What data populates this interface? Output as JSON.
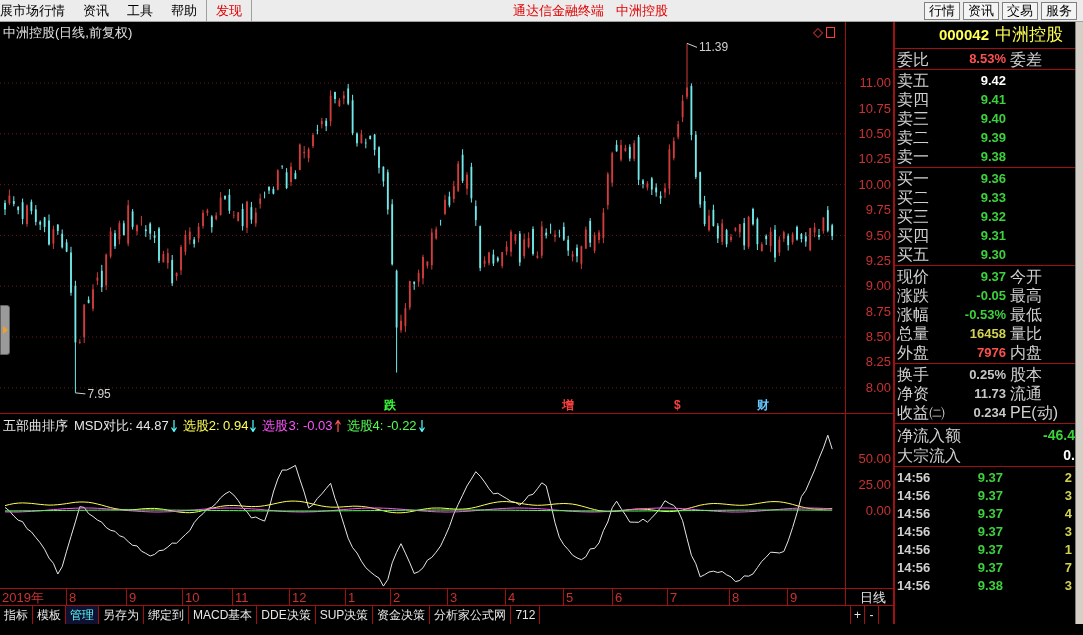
{
  "menu_bar": {
    "items": [
      {
        "label": "展市场行情",
        "kind": "menu"
      },
      {
        "label": "资讯",
        "kind": "menu"
      },
      {
        "label": "工具",
        "kind": "menu"
      },
      {
        "label": "帮助",
        "kind": "menu"
      },
      {
        "label": "发现",
        "kind": "highlight"
      }
    ],
    "app_title": "通达信金融终端",
    "stock_title": "中洲控股",
    "buttons": [
      "行情",
      "资讯",
      "交易",
      "服务"
    ]
  },
  "price_chart": {
    "title": "中洲控股(日线,前复权)",
    "high_label": "11.39",
    "low_label": "7.95",
    "events": [
      {
        "label": "跌",
        "color": "#3cff3c"
      },
      {
        "label": "增",
        "color": "#ff4040"
      },
      {
        "label": "$",
        "color": "#ff4040"
      },
      {
        "label": "财",
        "color": "#64c8ff"
      }
    ],
    "axis_labels": [
      "11.00",
      "10.75",
      "10.50",
      "10.25",
      "10.00",
      "9.75",
      "9.50",
      "9.25",
      "9.00",
      "8.75",
      "8.50",
      "8.25",
      "8.00"
    ]
  },
  "indicator": {
    "name": "五部曲排序",
    "lines": [
      {
        "text": "MSD对比: 44.87",
        "rising": false,
        "color": "#e6e6e6"
      },
      {
        "text": "选股2: 0.94",
        "rising": false,
        "color": "#ffff54"
      },
      {
        "text": "选股3: -0.03",
        "rising": true,
        "color": "#ff54ff"
      },
      {
        "text": "选股4: -0.22",
        "rising": false,
        "color": "#54ff54"
      }
    ],
    "axis_labels": [
      "50.00",
      "25.00",
      "0.00"
    ]
  },
  "time_axis": {
    "labels": [
      "2019年",
      "8",
      "9",
      "10",
      "11",
      "12",
      "1",
      "2",
      "3",
      "4",
      "5",
      "6",
      "7",
      "8",
      "9"
    ],
    "period": "日线"
  },
  "tab_bar": {
    "tabs": [
      {
        "label": "指标",
        "selected": false
      },
      {
        "label": "模板",
        "selected": false
      },
      {
        "label": "管理",
        "selected": true
      },
      {
        "label": "另存为",
        "selected": false
      },
      {
        "label": "绑定到",
        "selected": false
      },
      {
        "label": "MACD基本",
        "selected": false
      },
      {
        "label": "DDE决策",
        "selected": false
      },
      {
        "label": "SUP决策",
        "selected": false
      },
      {
        "label": "资金决策",
        "selected": false
      },
      {
        "label": "分析家公式网",
        "selected": false
      },
      {
        "label": "712",
        "selected": false
      }
    ],
    "zoom_buttons": [
      "+",
      "-"
    ]
  },
  "quote_panel": {
    "code": "000042",
    "name": "中洲控股",
    "ratio": {
      "label": "委比",
      "value": "8.53%",
      "label_2": "委差"
    },
    "asks": [
      {
        "label": "卖五",
        "price": "9.42",
        "color": "#ffffff"
      },
      {
        "label": "卖四",
        "price": "9.41",
        "color": "#3cd23c"
      },
      {
        "label": "卖三",
        "price": "9.40",
        "color": "#3cd23c"
      },
      {
        "label": "卖二",
        "price": "9.39",
        "color": "#3cd23c"
      },
      {
        "label": "卖一",
        "price": "9.38",
        "color": "#3cd23c"
      }
    ],
    "bids": [
      {
        "label": "买一",
        "price": "9.36"
      },
      {
        "label": "买二",
        "price": "9.33"
      },
      {
        "label": "买三",
        "price": "9.32"
      },
      {
        "label": "买四",
        "price": "9.31"
      },
      {
        "label": "买五",
        "price": "9.30"
      }
    ],
    "stats": [
      {
        "label": "现价",
        "value": "9.37",
        "color": "#3cd23c",
        "label_2": "今开"
      },
      {
        "label": "涨跌",
        "value": "-0.05",
        "color": "#3cd23c",
        "label_2": "最高"
      },
      {
        "label": "涨幅",
        "value": "-0.53%",
        "color": "#3cd23c",
        "label_2": "最低"
      },
      {
        "label": "总量",
        "value": "16458",
        "color": "#d2d250",
        "label_2": "量比"
      },
      {
        "label": "外盘",
        "value": "7976",
        "color": "#ff5050",
        "label_2": "内盘"
      }
    ],
    "fundamentals": [
      {
        "label": "换手",
        "value": "0.25%",
        "label_2": "股本"
      },
      {
        "label": "净资",
        "value": "11.73",
        "label_2": "流通"
      },
      {
        "label": "收益㈡",
        "value": "0.234",
        "label_2": "PE(动)"
      }
    ],
    "flows": [
      {
        "label": "净流入额",
        "value": "-46.4",
        "color": "#3cd23c"
      },
      {
        "label": "大宗流入",
        "value": "0.",
        "color": "#ffffff"
      }
    ],
    "trades": [
      {
        "time": "14:56",
        "price": "9.37",
        "volume": "2"
      },
      {
        "time": "14:56",
        "price": "9.37",
        "volume": "3"
      },
      {
        "time": "14:56",
        "price": "9.37",
        "volume": "4"
      },
      {
        "time": "14:56",
        "price": "9.37",
        "volume": "3"
      },
      {
        "time": "14:56",
        "price": "9.37",
        "volume": "1"
      },
      {
        "time": "14:56",
        "price": "9.37",
        "volume": "7"
      },
      {
        "time": "14:56",
        "price": "9.38",
        "volume": "3"
      }
    ]
  }
}
